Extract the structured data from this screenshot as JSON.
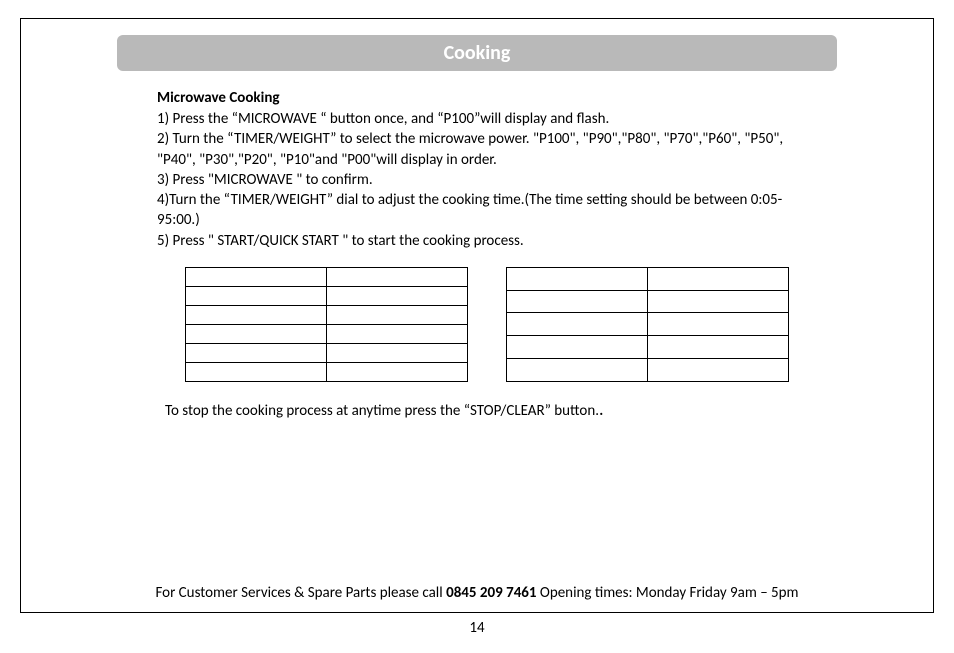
{
  "banner": {
    "title": "Cooking"
  },
  "section": {
    "subhead": "Microwave Cooking",
    "steps": {
      "s1": "1) Press the “MICROWAVE “ button once, and “P100”will display and flash.",
      "s2": "2) Turn the “TIMER/WEIGHT” to select the microwave power. \"P100\", \"P90\",\"P80\", \"P70\",\"P60\", \"P50\", \"P40\", \"P30\",\"P20\", \"P10\"and \"P00\"will display in order.",
      "s3": "3) Press  \"MICROWAVE \" to confirm.",
      "s4": "4)Turn the “TIMER/WEIGHT” dial to adjust the cooking time.(The time setting should be  between 0:05-95:00.)",
      "s5": "5) Press  \" START/QUICK START \" to start the cooking process."
    },
    "stop_line": "To stop the cooking process at anytime press the “STOP/CLEAR” button."
  },
  "tables": {
    "left": {
      "rows": 6,
      "cols": 2
    },
    "right": {
      "rows": 5,
      "cols": 2
    }
  },
  "footer": {
    "prefix": "For Customer Services & Spare Parts please call ",
    "phone": "0845 209 7461",
    "suffix": " Opening times: Monday  Friday  9am – 5pm"
  },
  "page_number": "14"
}
